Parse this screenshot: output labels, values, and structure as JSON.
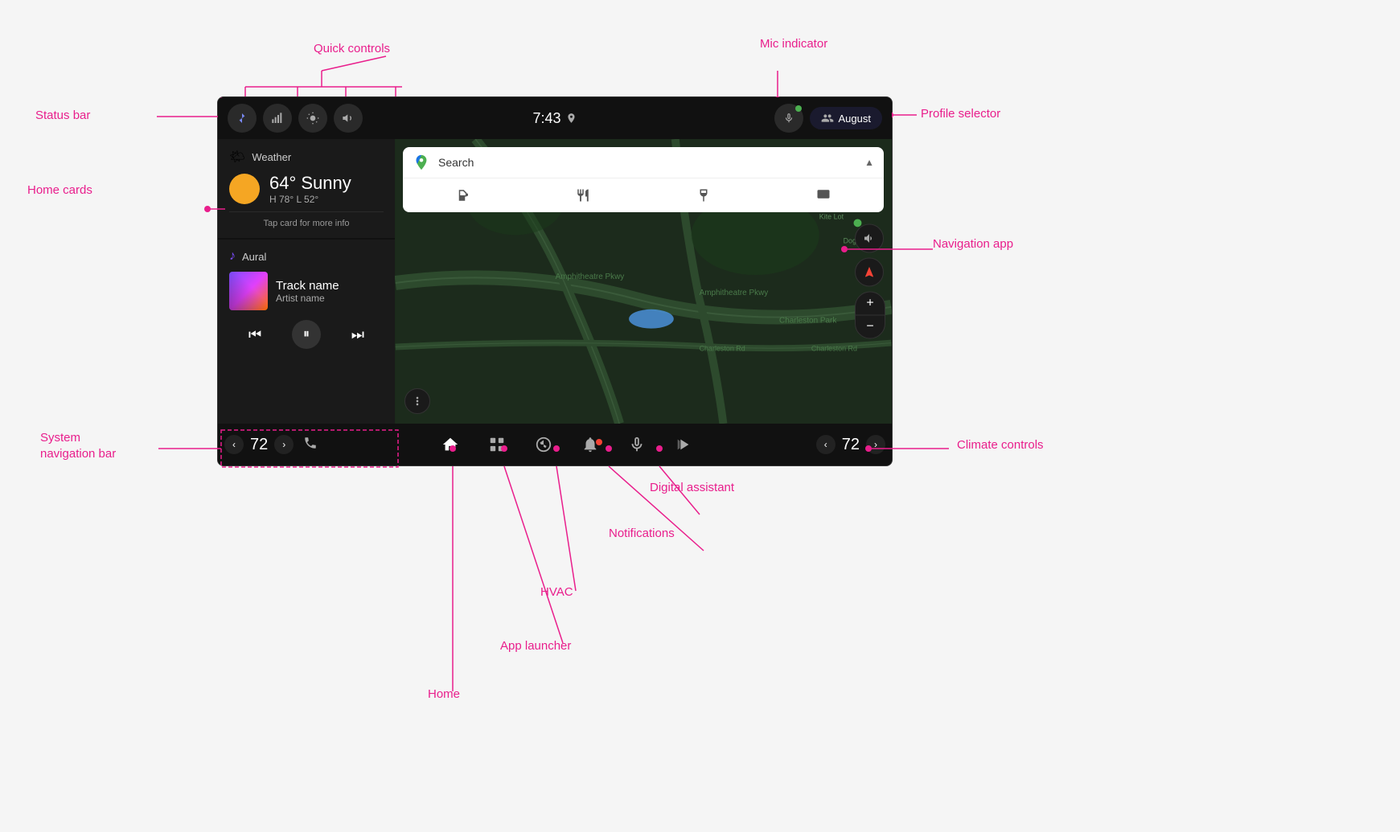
{
  "labels": {
    "quick_controls": "Quick controls",
    "status_bar": "Status bar",
    "home_cards": "Home cards",
    "system_nav_bar": "System navigation bar",
    "home": "Home",
    "app_launcher": "App launcher",
    "hvac": "HVAC",
    "notifications": "Notifications",
    "digital_assistant": "Digital assistant",
    "navigation_app": "Navigation app",
    "mic_indicator": "Mic indicator",
    "profile_selector": "Profile selector",
    "climate_controls": "Climate controls"
  },
  "status_bar": {
    "time": "7:43",
    "profile_name": "August"
  },
  "weather": {
    "title": "Weather",
    "temperature": "64° Sunny",
    "range": "H 78° L 52°",
    "tap_hint": "Tap card for more info"
  },
  "music": {
    "app_name": "Aural",
    "track_name": "Track name",
    "artist_name": "Artist name"
  },
  "search": {
    "placeholder": "Search"
  },
  "climate": {
    "temp_left": "72",
    "temp_right": "72"
  },
  "icons": {
    "bluetooth": "⚡",
    "signal": "📶",
    "brightness": "☀",
    "volume": "🔊",
    "mic": "🎤",
    "home": "⌂",
    "grid": "⊞",
    "fan": "❄",
    "bell": "🔔",
    "assistant": "🎙",
    "phone": "📞"
  }
}
